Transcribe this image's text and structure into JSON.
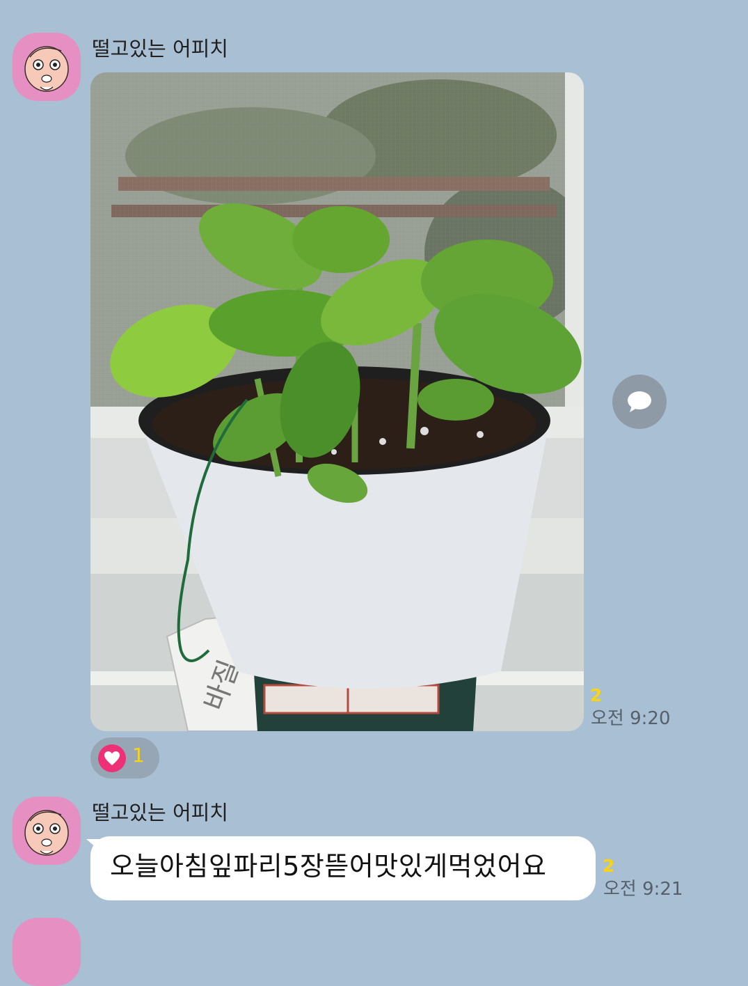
{
  "messages": [
    {
      "sender": "떨고있는 어피치",
      "type": "photo",
      "unread_count": "2",
      "time": "오전 9:20",
      "reaction": {
        "icon": "heart-icon",
        "count": "1"
      }
    },
    {
      "sender": "떨고있는 어피치",
      "type": "text",
      "text": "오늘아침잎파리5장뜯어맛있게먹었어요",
      "unread_count": "2",
      "time": "오전 9:21"
    }
  ],
  "photo": {
    "label_text": "바질"
  },
  "colors": {
    "background": "#a9bfd3",
    "avatar": "#e58fc3",
    "unread": "#f9d416",
    "heart": "#ee3177",
    "share_button": "#8e9aa5"
  },
  "icons": {
    "share": "speech-bubble-icon",
    "reaction": "heart-icon"
  }
}
